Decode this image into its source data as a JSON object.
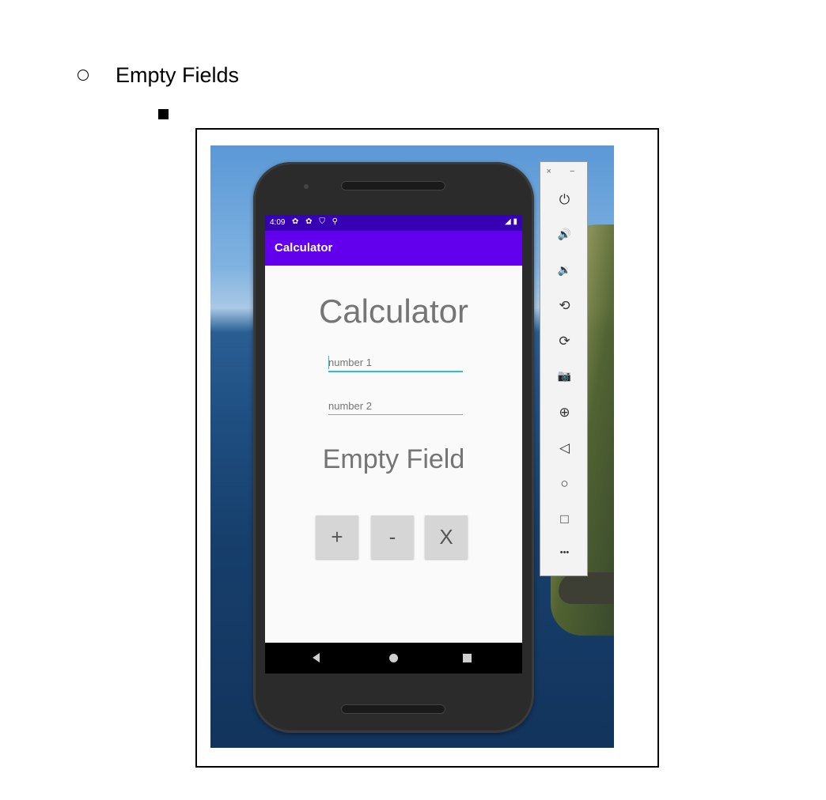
{
  "document": {
    "heading": "Empty Fields"
  },
  "emulator": {
    "status_time": "4:09",
    "status_icons": "✿ ✿ ⛉ ⚲",
    "status_right": "◢ ▮",
    "app_title": "Calculator",
    "calc_title": "Calculator",
    "input1_placeholder": "number 1",
    "input2_placeholder": "number 2",
    "result_text": "Empty Field",
    "buttons": {
      "plus": "+",
      "minus": "-",
      "times": "X"
    }
  },
  "toolbar": {
    "window_controls": "× −",
    "icons": {
      "power": "⏻",
      "volume_up": "🔊",
      "volume_down": "🔉",
      "rotate_left": "⟲",
      "rotate_right": "⟳",
      "camera": "📷",
      "zoom": "⊕",
      "back": "◁",
      "home": "○",
      "overview": "□",
      "more": "•••"
    }
  },
  "colors": {
    "status_bar": "#3700b3",
    "app_bar": "#6200ee",
    "input_focus": "#26c6c1"
  }
}
